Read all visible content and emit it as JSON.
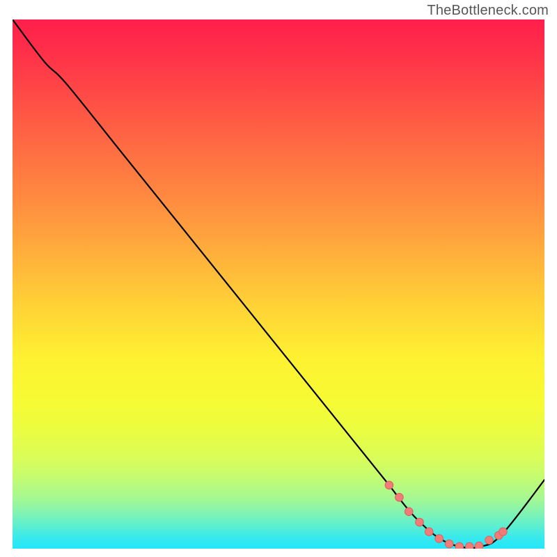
{
  "attribution": "TheBottleneck.com",
  "chart_data": {
    "type": "line",
    "title": "",
    "xlabel": "",
    "ylabel": "",
    "xlim": [
      0,
      100
    ],
    "ylim": [
      0,
      100
    ],
    "legend": false,
    "grid": false,
    "gradient": [
      "#ff1f4b",
      "#ff6b43",
      "#ffd236",
      "#fef131",
      "#85f4af",
      "#24e6f9"
    ],
    "series": [
      {
        "name": "bottleneck-curve",
        "x": [
          0,
          6,
          10,
          20,
          30,
          40,
          50,
          60,
          70,
          73,
          76,
          80,
          84,
          88,
          92,
          100
        ],
        "values": [
          100,
          92,
          88,
          75.5,
          63,
          50.5,
          38,
          25.5,
          13,
          9.1,
          5.6,
          2.1,
          0.4,
          0.4,
          2.7,
          13
        ]
      }
    ],
    "markers": {
      "name": "highlighted-points",
      "color": "#ef7c78",
      "x": [
        70.8,
        72.7,
        74.5,
        76.5,
        78.3,
        80.2,
        82.1,
        84.0,
        85.9,
        87.7,
        89.6,
        91.4,
        92.2
      ],
      "values": [
        12.0,
        9.7,
        7.0,
        5.0,
        3.2,
        1.9,
        0.9,
        0.4,
        0.4,
        0.5,
        1.6,
        2.5,
        3.2
      ]
    }
  }
}
